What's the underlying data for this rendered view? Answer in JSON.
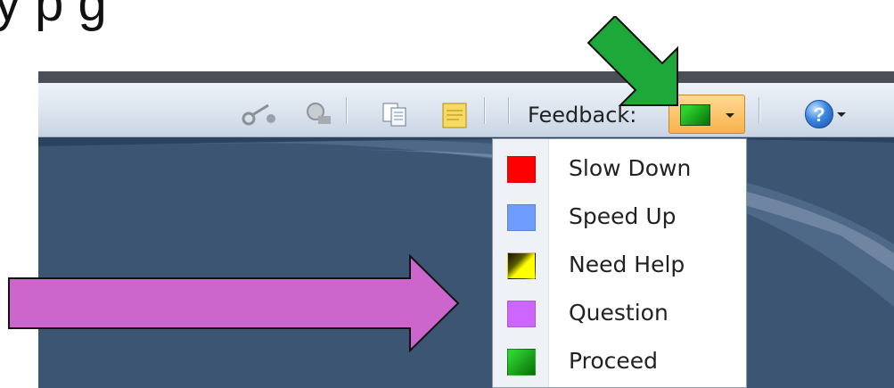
{
  "slide": {
    "caption_visible": "y                      p                                  g"
  },
  "toolbar": {
    "icons": [
      "connect-icon",
      "search-people-icon",
      "copy-icon",
      "notes-icon",
      "help-icon"
    ],
    "feedback_label": "Feedback:",
    "feedback_selected_color": "#1fb51f"
  },
  "feedback_menu": {
    "items": [
      {
        "label": "Slow Down",
        "color": "#ff0000"
      },
      {
        "label": "Speed Up",
        "color": "#6699ff"
      },
      {
        "label": "Need Help",
        "color": "#ffff00"
      },
      {
        "label": "Question",
        "color": "#cc66ff"
      },
      {
        "label": "Proceed",
        "color": "#00c000"
      }
    ]
  },
  "annotations": {
    "green_arrow_color": "#1fa83a",
    "pink_arrow_color": "#cc66cc"
  }
}
